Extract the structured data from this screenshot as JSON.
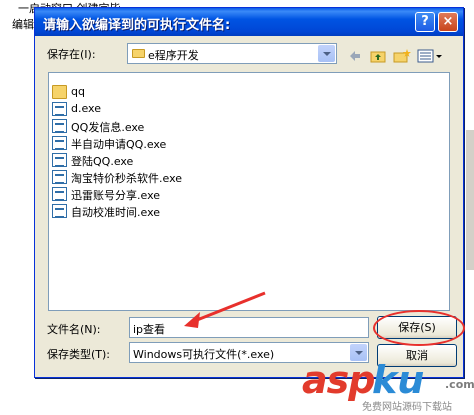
{
  "background": {
    "line1": "一启动窗口 创建完毕",
    "line2": "编辑"
  },
  "dialog": {
    "title": "请输入欲编译到的可执行文件名:",
    "help_glyph": "?",
    "close_glyph": "×",
    "save_in_label": "保存在(I):",
    "save_in_value": "e程序开发",
    "files": [
      {
        "name": "qq",
        "icon": "folder-icon"
      },
      {
        "name": "d.exe",
        "icon": "exe-icon"
      },
      {
        "name": "QQ发信息.exe",
        "icon": "exe-icon"
      },
      {
        "name": "半自动申请QQ.exe",
        "icon": "exe-icon"
      },
      {
        "name": "登陆QQ.exe",
        "icon": "exe-icon"
      },
      {
        "name": "淘宝特价秒杀软件.exe",
        "icon": "exe-icon"
      },
      {
        "name": "迅雷账号分享.exe",
        "icon": "exe-icon"
      },
      {
        "name": "自动校准时间.exe",
        "icon": "exe-icon"
      }
    ],
    "filename_label": "文件名(N):",
    "filename_value": "ip查看",
    "filetype_label": "保存类型(T):",
    "filetype_value": "Windows可执行文件(*.exe)",
    "save_button": "保存(S)",
    "cancel_button": "取消"
  },
  "watermark": {
    "asp": "asp",
    "ku": "ku",
    "com": ".com",
    "subtitle": "免费网站源码下载站"
  },
  "colors": {
    "titlebar": "#0054e3",
    "annotation": "#e8302c"
  }
}
